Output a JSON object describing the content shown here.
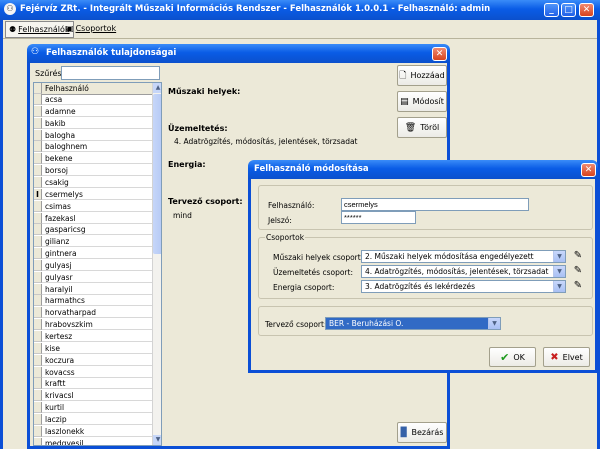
{
  "main_window": {
    "title": "Fejérvíz ZRt. - Integrált Műszaki Információs Rendszer - Felhasználók 1.0.0.1 - Felhasználó: admin",
    "toolbar": {
      "users": "Felhasználók",
      "groups": "Csoportok"
    }
  },
  "props_window": {
    "title": "Felhasználók tulajdonságai",
    "filter_label": "Szűrés:",
    "filter_value": "",
    "list_header": "Felhasználó",
    "users": [
      "acsa",
      "adamne",
      "bakib",
      "balogha",
      "baloghnem",
      "bekene",
      "borsoj",
      "csakig",
      "csermelys",
      "csimas",
      "fazekasl",
      "gasparicsg",
      "gilianz",
      "gintnera",
      "gulyasj",
      "gulyasr",
      "haralyil",
      "harmathcs",
      "horvatharpad",
      "hrabovszkim",
      "kertesz",
      "kise",
      "koczura",
      "kovacss",
      "kraftt",
      "krivacsl",
      "kurtil",
      "laczip",
      "laszlonekk",
      "medgyesil"
    ],
    "current_user": "csermelys",
    "sections": {
      "muszaki": {
        "title": "Műszaki helyek:",
        "value": ""
      },
      "uzemeltetes": {
        "title": "Üzemeltetés:",
        "value": "4. Adatrögzítés, módosítás, jelentések, törzsadat"
      },
      "energia": {
        "title": "Energia:",
        "value": ""
      },
      "tervezo": {
        "title": "Tervező csoport:",
        "value": "mind"
      }
    },
    "buttons": {
      "add": "Hozzáad",
      "edit": "Módosít",
      "delete": "Töröl",
      "close": "Bezárás"
    }
  },
  "edit_dialog": {
    "title": "Felhasználó módosítása",
    "username_label": "Felhasználó:",
    "username_value": "csermelys",
    "password_label": "Jelszó:",
    "password_value": "******",
    "groups_legend": "Csoportok",
    "muszaki_label": "Műszaki helyek csoport:",
    "muszaki_value": "2. Műszaki helyek módosítása engedélyezett",
    "uzem_label": "Üzemeltetés csoport:",
    "uzem_value": "4. Adatrögzítés, módosítás, jelentések, törzsadat",
    "energia_label": "Energia csoport:",
    "energia_value": "3. Adatrögzítés és lekérdezés",
    "tervezo_label": "Tervező csoport:",
    "tervezo_value": "BER - Beruházási O.",
    "ok": "OK",
    "cancel": "Elvet"
  },
  "colors": {
    "xp_blue": "#0a5ce6",
    "selected_row": "#316ac5",
    "dialog_bg": "#ece9d8"
  }
}
